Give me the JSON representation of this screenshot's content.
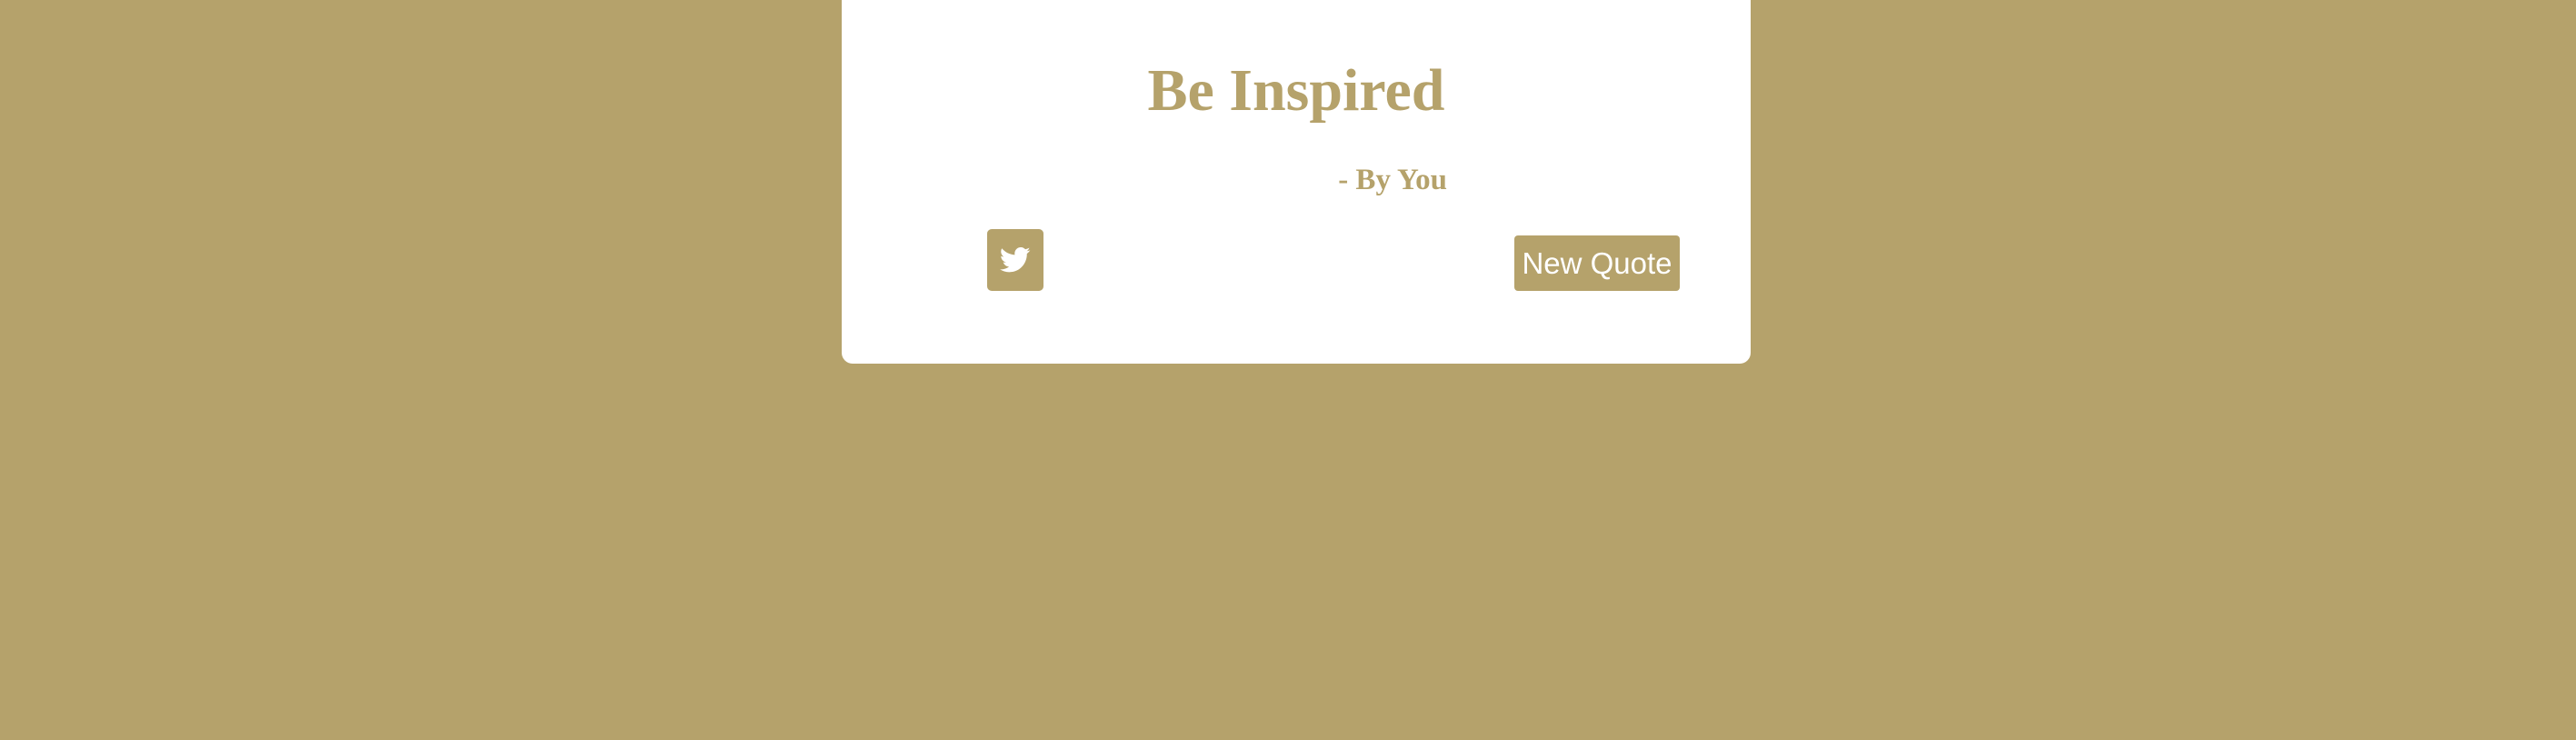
{
  "theme": {
    "accent_color": "#b5a26b",
    "card_color": "#ffffff",
    "button_text_color": "#ffffff"
  },
  "quote": {
    "text": "Be Inspired",
    "author": "- By You"
  },
  "actions": {
    "tweet_icon": "twitter-icon",
    "new_quote_label": "New Quote"
  }
}
